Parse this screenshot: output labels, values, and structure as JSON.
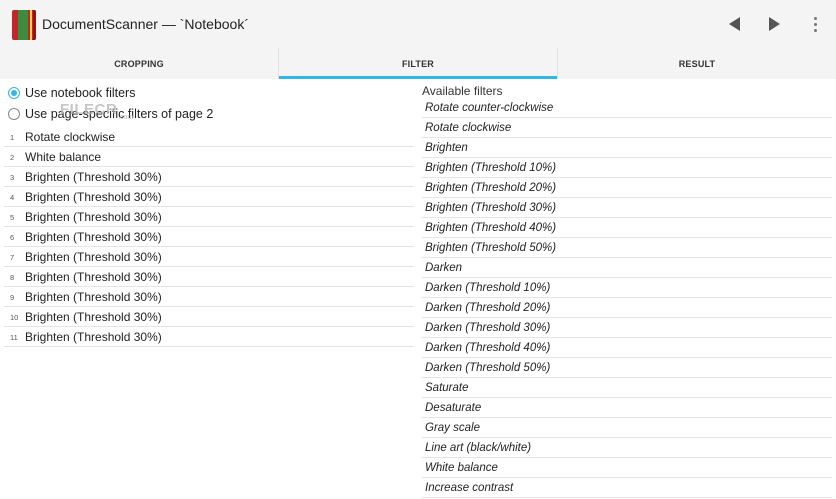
{
  "header": {
    "title": "DocumentScanner — `Notebook´",
    "app_icon": "notebook-icon",
    "prev_icon": "prev-arrow-icon",
    "next_icon": "next-arrow-icon",
    "menu_icon": "overflow-menu-icon"
  },
  "tabs": [
    {
      "label": "CROPPING",
      "active": false
    },
    {
      "label": "FILTER",
      "active": true
    },
    {
      "label": "RESULT",
      "active": false
    }
  ],
  "colors": {
    "accent": "#33b5e5",
    "app_icon_red": "#c0262b"
  },
  "filter_mode": {
    "options": [
      {
        "label": "Use notebook filters",
        "checked": true
      },
      {
        "label": "Use page-specific filters of page 2",
        "checked": false
      }
    ],
    "watermark": "FILECR",
    "watermark_sub": ".com"
  },
  "applied_filters": [
    {
      "num": "1",
      "label": "Rotate clockwise"
    },
    {
      "num": "2",
      "label": "White balance"
    },
    {
      "num": "3",
      "label": "Brighten (Threshold 30%)"
    },
    {
      "num": "4",
      "label": "Brighten (Threshold 30%)"
    },
    {
      "num": "5",
      "label": "Brighten (Threshold 30%)"
    },
    {
      "num": "6",
      "label": "Brighten (Threshold 30%)"
    },
    {
      "num": "7",
      "label": "Brighten (Threshold 30%)"
    },
    {
      "num": "8",
      "label": "Brighten (Threshold 30%)"
    },
    {
      "num": "9",
      "label": "Brighten (Threshold 30%)"
    },
    {
      "num": "10",
      "label": "Brighten (Threshold 30%)"
    },
    {
      "num": "11",
      "label": "Brighten (Threshold 30%)"
    }
  ],
  "available": {
    "header": "Available filters",
    "items": [
      "Rotate counter-clockwise",
      "Rotate clockwise",
      "Brighten",
      "Brighten (Threshold 10%)",
      "Brighten (Threshold 20%)",
      "Brighten (Threshold 30%)",
      "Brighten (Threshold 40%)",
      "Brighten (Threshold 50%)",
      "Darken",
      "Darken (Threshold 10%)",
      "Darken (Threshold 20%)",
      "Darken (Threshold 30%)",
      "Darken (Threshold 40%)",
      "Darken (Threshold 50%)",
      "Saturate",
      "Desaturate",
      "Gray scale",
      "Line art (black/white)",
      "White balance",
      "Increase contrast"
    ]
  }
}
